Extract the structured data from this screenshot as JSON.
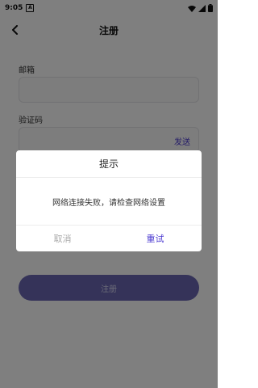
{
  "status_bar": {
    "time": "9:05",
    "notification_icon_letter": "A",
    "icons": [
      "wifi-icon",
      "signal-icon",
      "battery-icon"
    ]
  },
  "app_bar": {
    "title": "注册",
    "back_icon": "back-arrow-icon"
  },
  "form": {
    "email_label": "邮箱",
    "email_value": "",
    "code_label": "验证码",
    "code_value": "",
    "send_code_label": "发送",
    "register_label": "注册"
  },
  "dialog": {
    "title": "提示",
    "message": "网络连接失败，请检查网络设置",
    "cancel_label": "取消",
    "retry_label": "重试"
  },
  "colors": {
    "accent": "#4a38d0",
    "button_fill": "#6a67b3",
    "overlay": "rgba(0,0,0,0.5)"
  }
}
